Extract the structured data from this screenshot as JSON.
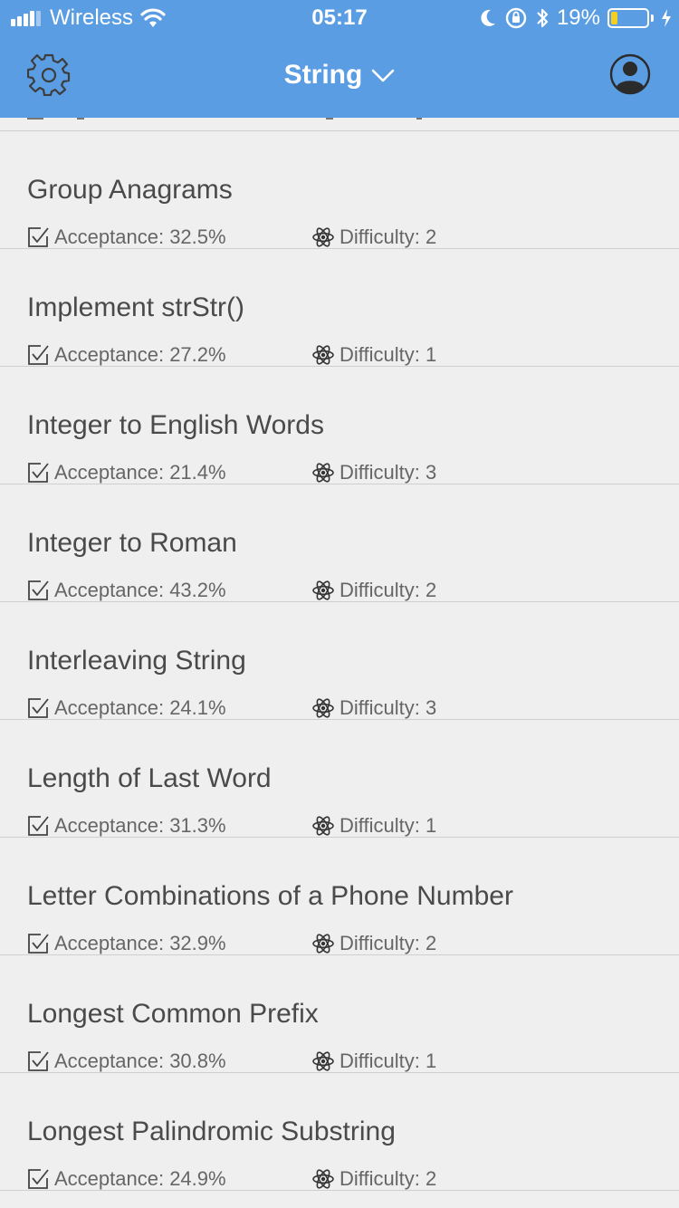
{
  "status_bar": {
    "carrier": "Wireless",
    "time": "05:17",
    "battery_percent": "19%",
    "battery_level": 0.19,
    "icons": [
      "signal-icon",
      "wifi-icon",
      "moon-icon",
      "orientation-lock-icon",
      "bluetooth-icon",
      "battery-icon",
      "charging-icon"
    ]
  },
  "header": {
    "title": "String",
    "left_icon": "gear-icon",
    "right_icon": "user-profile-icon",
    "title_icon": "chevron-down-icon",
    "background": "#5b9de2"
  },
  "problems": [
    {
      "title": "Group Anagrams",
      "acceptance": "Acceptance: 32.5%",
      "difficulty": "Difficulty: 2"
    },
    {
      "title": "Implement strStr()",
      "acceptance": "Acceptance: 27.2%",
      "difficulty": "Difficulty: 1"
    },
    {
      "title": "Integer to English Words",
      "acceptance": "Acceptance: 21.4%",
      "difficulty": "Difficulty: 3"
    },
    {
      "title": "Integer to Roman",
      "acceptance": "Acceptance: 43.2%",
      "difficulty": "Difficulty: 2"
    },
    {
      "title": "Interleaving String",
      "acceptance": "Acceptance: 24.1%",
      "difficulty": "Difficulty: 3"
    },
    {
      "title": "Length of Last Word",
      "acceptance": "Acceptance: 31.3%",
      "difficulty": "Difficulty: 1"
    },
    {
      "title": "Letter Combinations of a Phone Number",
      "acceptance": "Acceptance: 32.9%",
      "difficulty": "Difficulty: 2"
    },
    {
      "title": "Longest Common Prefix",
      "acceptance": "Acceptance: 30.8%",
      "difficulty": "Difficulty: 1"
    },
    {
      "title": "Longest Palindromic Substring",
      "acceptance": "Acceptance: 24.9%",
      "difficulty": "Difficulty: 2"
    }
  ]
}
